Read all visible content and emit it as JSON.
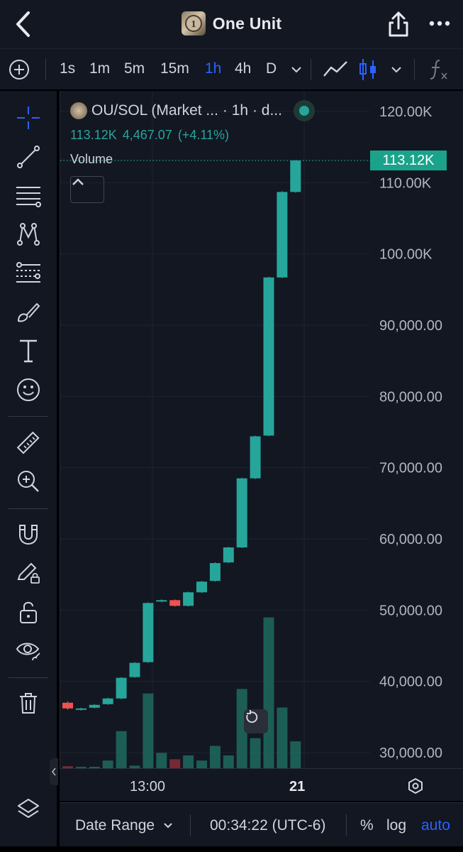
{
  "header": {
    "title": "One Unit"
  },
  "toolbar": {
    "intervals": [
      {
        "label": "1s",
        "active": false
      },
      {
        "label": "1m",
        "active": false
      },
      {
        "label": "5m",
        "active": false
      },
      {
        "label": "15m",
        "active": false
      },
      {
        "label": "1h",
        "active": true
      },
      {
        "label": "4h",
        "active": false
      },
      {
        "label": "D",
        "active": false
      }
    ]
  },
  "legend": {
    "symbol": "OU/SOL (Market ...",
    "interval": "· 1h · d...",
    "last": "113.12K",
    "change": "4,467.07",
    "change_pct": "(+4.11%)",
    "volume_label": "Volume"
  },
  "price_axis": {
    "labels": [
      "120.00K",
      "110.00K",
      "100.00K",
      "90,000.00",
      "80,000.00",
      "70,000.00",
      "60,000.00",
      "50,000.00",
      "40,000.00",
      "30,000.00"
    ],
    "current_price_tag": "113.12K"
  },
  "time_axis": {
    "labels": [
      {
        "text": "13:00",
        "bold": false
      },
      {
        "text": "21",
        "bold": true
      }
    ]
  },
  "bottom_bar": {
    "date_range": "Date Range",
    "clock": "00:34:22 (UTC-6)",
    "percent": "%",
    "log": "log",
    "auto": "auto"
  },
  "colors": {
    "up": "#26a69a",
    "down": "#ef5350",
    "accent": "#2962ff",
    "background": "#131722"
  },
  "chart_data": {
    "type": "candlestick",
    "y_range": [
      29000,
      123000
    ],
    "price_ticks": [
      120000,
      110000,
      100000,
      90000,
      80000,
      70000,
      60000,
      50000,
      40000,
      30000
    ],
    "candles": [
      {
        "o": 37000,
        "c": 36200,
        "h": 37200,
        "l": 36000
      },
      {
        "o": 36000,
        "c": 36200,
        "h": 36300,
        "l": 35900
      },
      {
        "o": 36300,
        "c": 36700,
        "h": 36800,
        "l": 36200
      },
      {
        "o": 36800,
        "c": 37600,
        "h": 37700,
        "l": 36700
      },
      {
        "o": 37600,
        "c": 40500,
        "h": 40600,
        "l": 37500
      },
      {
        "o": 40600,
        "c": 42600,
        "h": 42700,
        "l": 40500
      },
      {
        "o": 42700,
        "c": 51000,
        "h": 51100,
        "l": 42600
      },
      {
        "o": 51200,
        "c": 51400,
        "h": 51500,
        "l": 51100
      },
      {
        "o": 51400,
        "c": 50600,
        "h": 51500,
        "l": 50500
      },
      {
        "o": 50600,
        "c": 52500,
        "h": 52600,
        "l": 50500
      },
      {
        "o": 52500,
        "c": 54000,
        "h": 54100,
        "l": 52400
      },
      {
        "o": 54100,
        "c": 56600,
        "h": 56700,
        "l": 54000
      },
      {
        "o": 56700,
        "c": 58800,
        "h": 58900,
        "l": 56600
      },
      {
        "o": 58800,
        "c": 68500,
        "h": 68600,
        "l": 58700
      },
      {
        "o": 68500,
        "c": 74400,
        "h": 74500,
        "l": 68400
      },
      {
        "o": 74500,
        "c": 96700,
        "h": 96800,
        "l": 74400
      },
      {
        "o": 96700,
        "c": 108700,
        "h": 108800,
        "l": 96600
      },
      {
        "o": 108700,
        "c": 113120,
        "h": 113200,
        "l": 108600
      }
    ],
    "volume": [
      {
        "v": 3,
        "up": false
      },
      {
        "v": 2,
        "up": true
      },
      {
        "v": 2,
        "up": true
      },
      {
        "v": 12,
        "up": true
      },
      {
        "v": 58,
        "up": true
      },
      {
        "v": 4,
        "up": true
      },
      {
        "v": 117,
        "up": true
      },
      {
        "v": 24,
        "up": true
      },
      {
        "v": 14,
        "up": false
      },
      {
        "v": 20,
        "up": true
      },
      {
        "v": 12,
        "up": true
      },
      {
        "v": 35,
        "up": true
      },
      {
        "v": 20,
        "up": true
      },
      {
        "v": 124,
        "up": true
      },
      {
        "v": 47,
        "up": true
      },
      {
        "v": 236,
        "up": true
      },
      {
        "v": 95,
        "up": true
      },
      {
        "v": 42,
        "up": true
      }
    ]
  }
}
